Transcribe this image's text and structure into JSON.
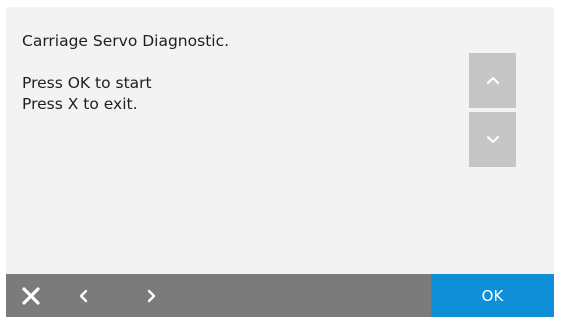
{
  "message": {
    "title": "Carriage Servo Diagnostic.",
    "lines": [
      "Press OK to start",
      "Press X to exit."
    ]
  },
  "scroll": {
    "up_icon": "chevron-up-icon",
    "down_icon": "chevron-down-icon"
  },
  "footer": {
    "cancel_icon": "close-icon",
    "prev_icon": "chevron-left-icon",
    "next_icon": "chevron-right-icon",
    "ok_label": "OK"
  },
  "colors": {
    "screen_background": "#f3f3f3",
    "scroll_button": "#c6c6c6",
    "footer_bar": "#7b7b7b",
    "ok_accent": "#0f8fd6",
    "text": "#1f1f1f"
  }
}
